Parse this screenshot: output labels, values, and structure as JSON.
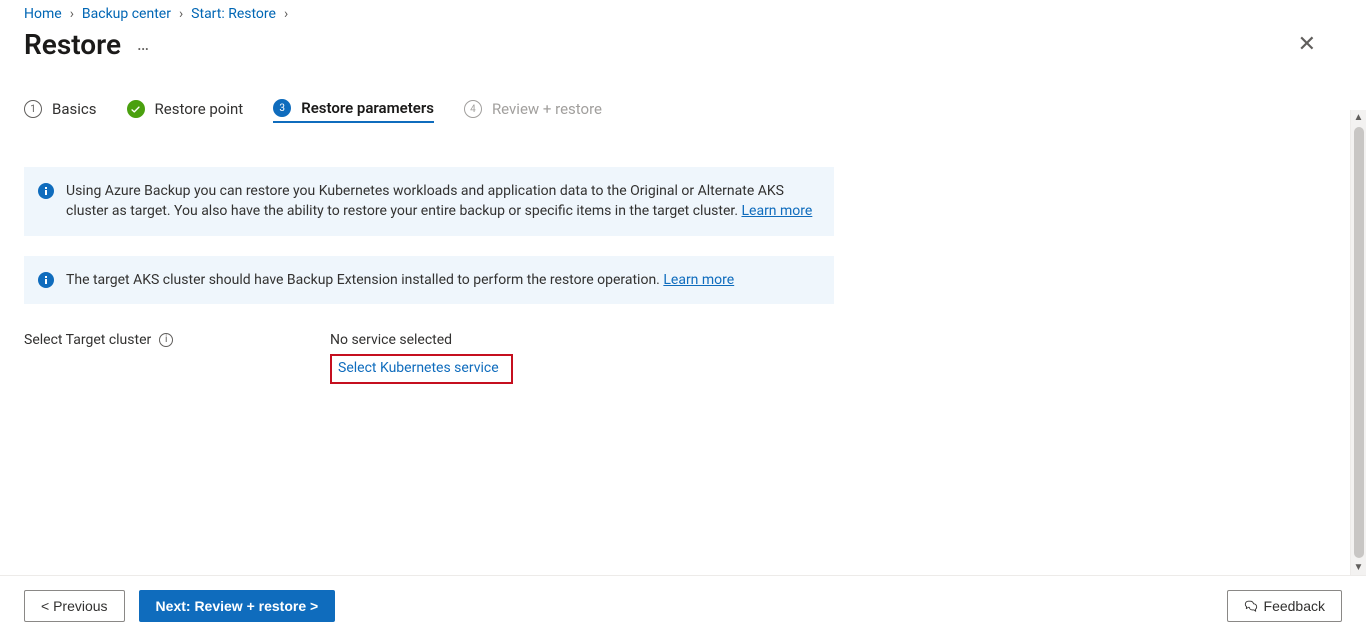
{
  "breadcrumb": [
    {
      "label": "Home"
    },
    {
      "label": "Backup center"
    },
    {
      "label": "Start: Restore"
    }
  ],
  "page": {
    "title": "Restore"
  },
  "steps": [
    {
      "label": "Basics",
      "state": "done",
      "indicator": "1"
    },
    {
      "label": "Restore point",
      "state": "complete",
      "indicator": "✓"
    },
    {
      "label": "Restore parameters",
      "state": "active",
      "indicator": "3"
    },
    {
      "label": "Review + restore",
      "state": "disabled",
      "indicator": "4"
    }
  ],
  "info": {
    "box1_text": "Using Azure Backup you can restore you Kubernetes workloads and application data to the Original or Alternate AKS cluster as target. You also have the ability to restore your entire backup or specific items in the target cluster. ",
    "box1_learn": "Learn more",
    "box2_text": "The target AKS cluster should have Backup Extension installed to perform the restore operation. ",
    "box2_learn": "Learn more"
  },
  "fields": {
    "target_cluster": {
      "label": "Select Target cluster",
      "value_status": "No service selected",
      "select_link": "Select Kubernetes service"
    }
  },
  "footer": {
    "previous": "< Previous",
    "next": "Next: Review + restore >",
    "feedback": "Feedback"
  }
}
